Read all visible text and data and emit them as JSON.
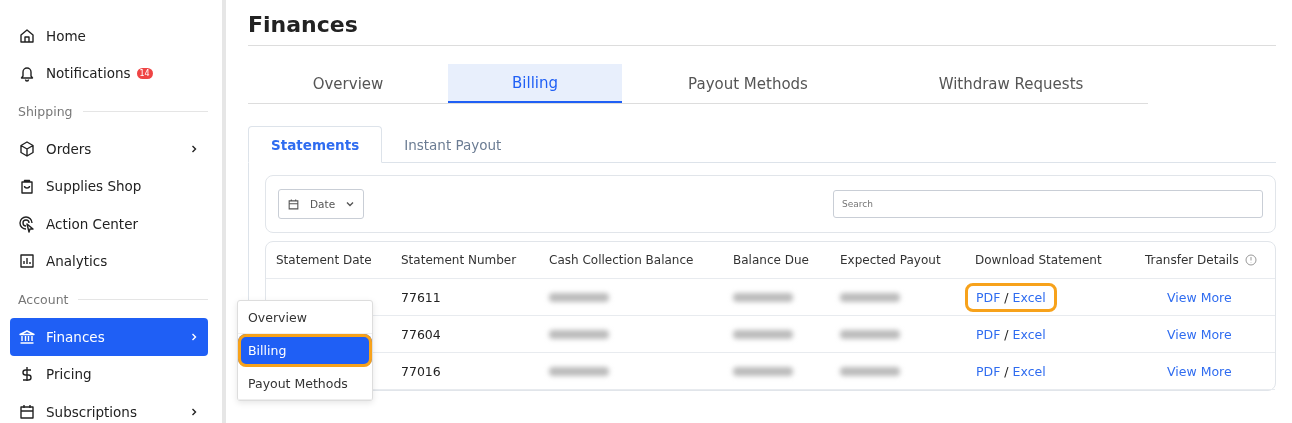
{
  "sidebar": {
    "items": [
      {
        "kind": "item",
        "label": "Home",
        "selected": false,
        "has_submenu": false
      },
      {
        "kind": "item",
        "label": "Notifications",
        "selected": false,
        "has_submenu": false,
        "badge": "14"
      },
      {
        "kind": "section",
        "label": "Shipping"
      },
      {
        "kind": "item",
        "label": "Orders",
        "selected": false,
        "has_submenu": true
      },
      {
        "kind": "item",
        "label": "Supplies Shop",
        "selected": false,
        "has_submenu": false
      },
      {
        "kind": "item",
        "label": "Action Center",
        "selected": false,
        "has_submenu": false
      },
      {
        "kind": "item",
        "label": "Analytics",
        "selected": false,
        "has_submenu": false
      },
      {
        "kind": "section",
        "label": "Account"
      },
      {
        "kind": "item",
        "label": "Finances",
        "selected": true,
        "has_submenu": true
      },
      {
        "kind": "item",
        "label": "Pricing",
        "selected": false,
        "has_submenu": false
      },
      {
        "kind": "item",
        "label": "Subscriptions",
        "selected": false,
        "has_submenu": true
      }
    ]
  },
  "page": {
    "title": "Finances"
  },
  "tabs": [
    {
      "label": "Overview",
      "selected": false
    },
    {
      "label": "Billing",
      "selected": true
    },
    {
      "label": "Payout Methods",
      "selected": false
    },
    {
      "label": "Withdraw Requests",
      "selected": false
    }
  ],
  "subtabs": [
    {
      "label": "Statements",
      "selected": true
    },
    {
      "label": "Instant Payout",
      "selected": false
    }
  ],
  "filter": {
    "date_label": "Date",
    "search_placeholder": "Search"
  },
  "table": {
    "columns": [
      "Statement Date",
      "Statement Number",
      "Cash Collection Balance",
      "Balance Due",
      "Expected Payout",
      "Download Statement",
      "Transfer Details"
    ],
    "rows": [
      {
        "statement_number": "77611",
        "pdf": "PDF",
        "separator": "/",
        "excel": "Excel",
        "details": "View More",
        "highlighted": true
      },
      {
        "statement_number": "77604",
        "pdf": "PDF",
        "separator": "/",
        "excel": "Excel",
        "details": "View More",
        "highlighted": false
      },
      {
        "statement_number": "77016",
        "pdf": "PDF",
        "separator": "/",
        "excel": "Excel",
        "details": "View More",
        "highlighted": false
      }
    ]
  },
  "popup_menu": {
    "items": [
      {
        "label": "Overview",
        "selected": false
      },
      {
        "label": "Billing",
        "selected": true
      },
      {
        "label": "Payout Methods",
        "selected": false
      }
    ]
  }
}
